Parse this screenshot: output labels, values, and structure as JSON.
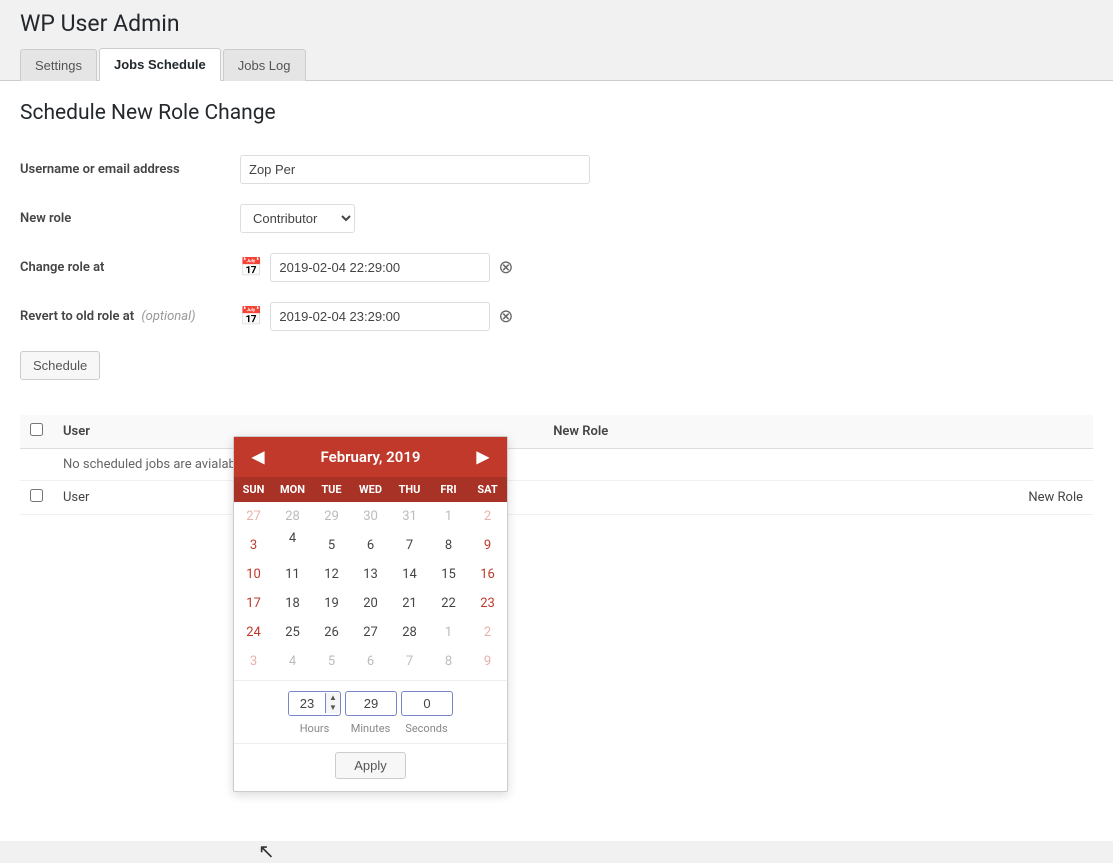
{
  "app": {
    "title": "WP User Admin"
  },
  "tabs": [
    {
      "id": "settings",
      "label": "Settings",
      "active": false
    },
    {
      "id": "jobs-schedule",
      "label": "Jobs Schedule",
      "active": true
    },
    {
      "id": "jobs-log",
      "label": "Jobs Log",
      "active": false
    }
  ],
  "form": {
    "section_title": "Schedule New Role Change",
    "username_label": "Username or email address",
    "username_value": "Zop Per",
    "new_role_label": "New role",
    "new_role_value": "Contributor",
    "change_role_label": "Change role at",
    "change_role_value": "2019-02-04 22:29:00",
    "revert_label": "Revert to old role at",
    "optional_label": "(optional)",
    "revert_value": "2019-02-04 23:29:00",
    "schedule_btn": "Schedule"
  },
  "calendar": {
    "month_label": "February, 2019",
    "prev_arrow": "◀",
    "next_arrow": "▶",
    "day_names": [
      "SUN",
      "MON",
      "TUE",
      "WED",
      "THU",
      "FRI",
      "SAT"
    ],
    "weeks": [
      [
        {
          "num": "27",
          "other": true,
          "weekend": true
        },
        {
          "num": "28",
          "other": true,
          "weekend": false
        },
        {
          "num": "29",
          "other": true,
          "weekend": false
        },
        {
          "num": "30",
          "other": true,
          "weekend": false
        },
        {
          "num": "31",
          "other": true,
          "weekend": false
        },
        {
          "num": "1",
          "other": true,
          "weekend": false
        },
        {
          "num": "2",
          "other": true,
          "weekend": true
        }
      ],
      [
        {
          "num": "3",
          "other": false,
          "weekend": true
        },
        {
          "num": "4",
          "other": false,
          "today": true,
          "weekend": false
        },
        {
          "num": "5",
          "other": false,
          "weekend": false
        },
        {
          "num": "6",
          "other": false,
          "weekend": false
        },
        {
          "num": "7",
          "other": false,
          "weekend": false
        },
        {
          "num": "8",
          "other": false,
          "weekend": false
        },
        {
          "num": "9",
          "other": false,
          "weekend": true
        }
      ],
      [
        {
          "num": "10",
          "other": false,
          "weekend": true
        },
        {
          "num": "11",
          "other": false,
          "weekend": false
        },
        {
          "num": "12",
          "other": false,
          "weekend": false
        },
        {
          "num": "13",
          "other": false,
          "weekend": false
        },
        {
          "num": "14",
          "other": false,
          "weekend": false
        },
        {
          "num": "15",
          "other": false,
          "weekend": false
        },
        {
          "num": "16",
          "other": false,
          "weekend": true
        }
      ],
      [
        {
          "num": "17",
          "other": false,
          "weekend": true
        },
        {
          "num": "18",
          "other": false,
          "weekend": false
        },
        {
          "num": "19",
          "other": false,
          "weekend": false
        },
        {
          "num": "20",
          "other": false,
          "weekend": false
        },
        {
          "num": "21",
          "other": false,
          "weekend": false
        },
        {
          "num": "22",
          "other": false,
          "weekend": false
        },
        {
          "num": "23",
          "other": false,
          "weekend": true
        }
      ],
      [
        {
          "num": "24",
          "other": false,
          "weekend": true
        },
        {
          "num": "25",
          "other": false,
          "weekend": false
        },
        {
          "num": "26",
          "other": false,
          "weekend": false
        },
        {
          "num": "27",
          "other": false,
          "weekend": false
        },
        {
          "num": "28",
          "other": false,
          "weekend": false
        },
        {
          "num": "1",
          "other": true,
          "weekend": false
        },
        {
          "num": "2",
          "other": true,
          "weekend": true
        }
      ],
      [
        {
          "num": "3",
          "other": true,
          "weekend": true
        },
        {
          "num": "4",
          "other": true,
          "weekend": false
        },
        {
          "num": "5",
          "other": true,
          "weekend": false
        },
        {
          "num": "6",
          "other": true,
          "weekend": false
        },
        {
          "num": "7",
          "other": true,
          "weekend": false
        },
        {
          "num": "8",
          "other": true,
          "weekend": false
        },
        {
          "num": "9",
          "other": true,
          "weekend": true
        }
      ]
    ],
    "hours": "23",
    "minutes": "29",
    "seconds": "0",
    "hours_label": "Hours",
    "minutes_label": "Minutes",
    "seconds_label": "Seconds",
    "apply_btn": "Apply"
  },
  "table": {
    "col_checkbox": "",
    "col_user": "User",
    "col_new_role": "New Role",
    "no_jobs_msg": "No scheduled jobs are avialable.",
    "row2_user": "User",
    "row2_new_role": "New Role"
  }
}
